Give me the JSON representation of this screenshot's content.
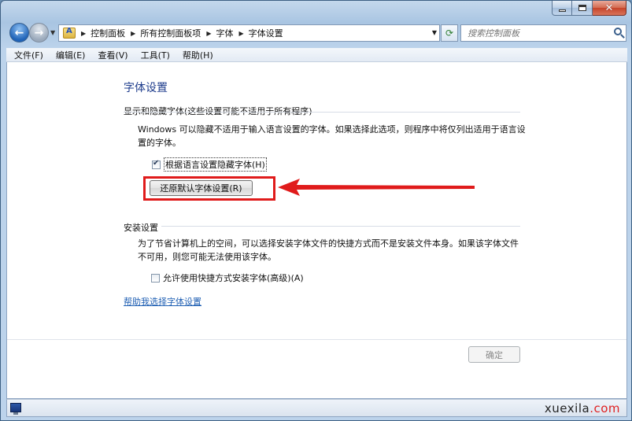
{
  "window": {
    "breadcrumbs": [
      "控制面板",
      "所有控制面板项",
      "字体",
      "字体设置"
    ],
    "search_placeholder": "搜索控制面板"
  },
  "menubar": {
    "items": [
      "文件(F)",
      "编辑(E)",
      "查看(V)",
      "工具(T)",
      "帮助(H)"
    ]
  },
  "content": {
    "title": "字体设置",
    "section1": {
      "heading": "显示和隐藏字体(这些设置可能不适用于所有程序)",
      "description": "Windows 可以隐藏不适用于输入语言设置的字体。如果选择此选项，则程序中将仅列出适用于语言设置的字体。",
      "checkbox_label": "根据语言设置隐藏字体(H)",
      "checkbox_checked": true,
      "restore_button": "还原默认字体设置(R)"
    },
    "section2": {
      "heading": "安装设置",
      "description": "为了节省计算机上的空间，可以选择安装字体文件的快捷方式而不是安装文件本身。如果该字体文件不可用，则您可能无法使用该字体。",
      "checkbox_label": "允许使用快捷方式安装字体(高级)(A)",
      "checkbox_checked": false
    },
    "help_link": "帮助我选择字体设置",
    "ok_button": "确定"
  },
  "watermark": {
    "part1": "xuexila",
    "part2": ".com"
  },
  "colors": {
    "title_blue": "#1e3c8c",
    "link_blue": "#1f5fb3",
    "highlight_red": "#e01b1b"
  }
}
